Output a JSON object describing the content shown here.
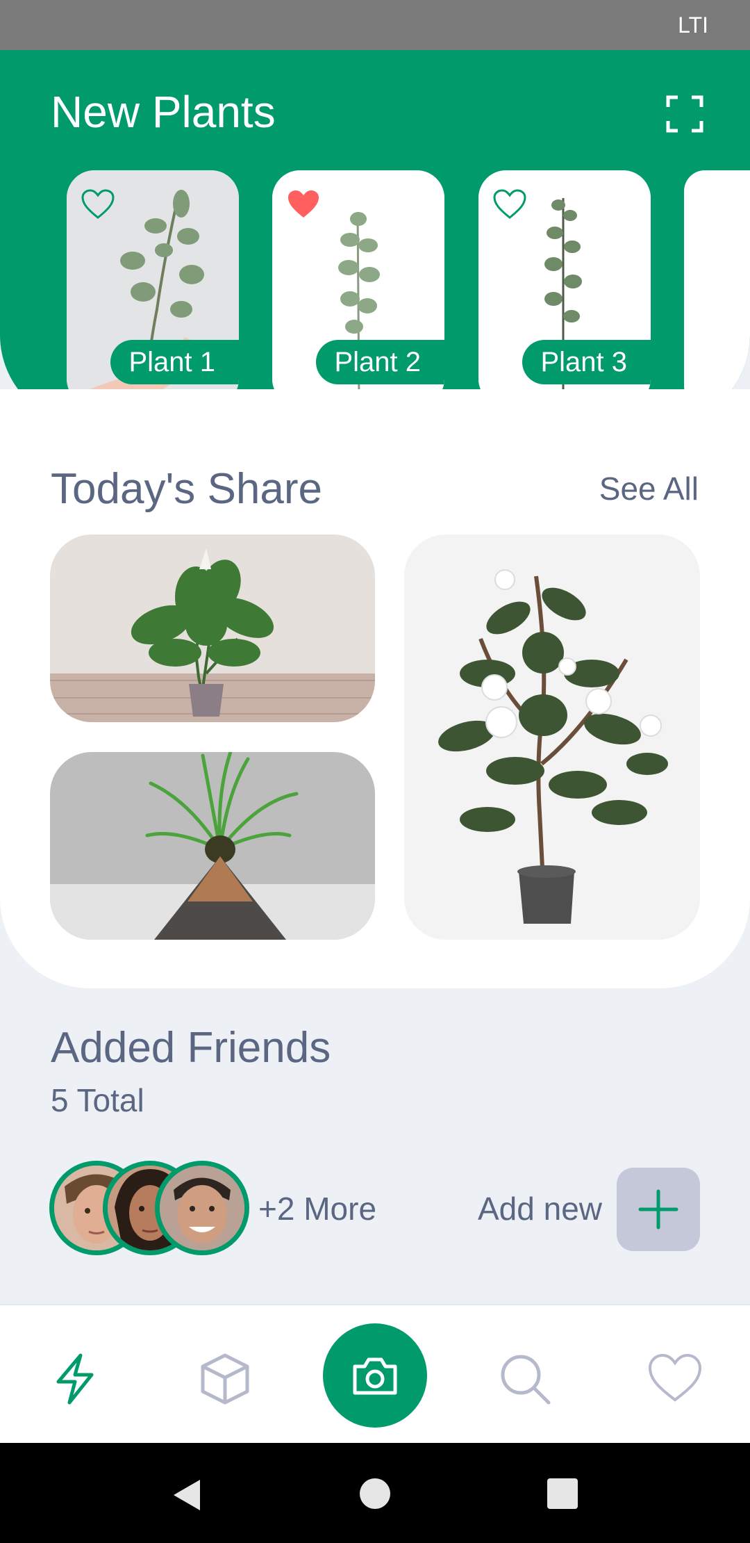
{
  "status_bar": {
    "carrier": "LTI"
  },
  "hero": {
    "title": "New Plants",
    "plants": [
      {
        "label": "Plant 1",
        "favorited": false
      },
      {
        "label": "Plant 2",
        "favorited": true
      },
      {
        "label": "Plant 3",
        "favorited": false
      }
    ]
  },
  "share": {
    "title": "Today's Share",
    "see_all": "See All"
  },
  "friends": {
    "title": "Added Friends",
    "total": "5 Total",
    "more": "+2 More",
    "add_new": "Add new"
  },
  "bottom_nav": [
    "activity-icon",
    "box-icon",
    "camera-icon",
    "search-icon",
    "heart-icon"
  ],
  "colors": {
    "primary": "#009a6b",
    "text": "#5b6683",
    "background": "#edf0f4",
    "favorite": "#ff5f5f",
    "muted": "#c5c8d8"
  }
}
